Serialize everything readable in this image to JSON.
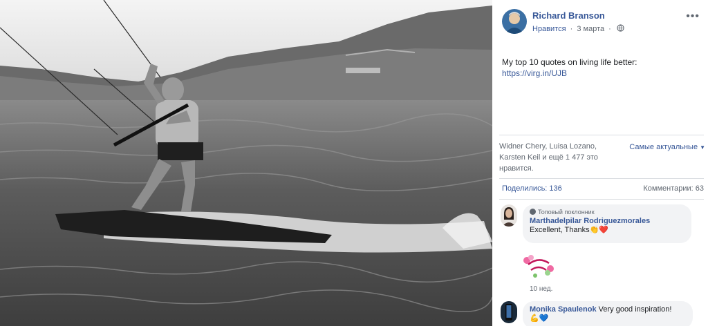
{
  "post": {
    "author": "Richard Branson",
    "like_link": "Нравится",
    "separator": "·",
    "date": "3 марта",
    "more_icon": "more-options-icon",
    "text": "My top 10 quotes on living life better:",
    "link": "https://virg.in/UJB"
  },
  "reactions": {
    "likes_text": "Widner Chery, Luisa Lozano, Karsten Keil и ещё 1 477 это нравится.",
    "sort_label": "Самые актуальные"
  },
  "stats": {
    "shares": "Поделились: 136",
    "comments": "Комментарии: 63"
  },
  "comments": [
    {
      "badge": "Топовый поклонник",
      "name": "Marthadelpilar Rodriguezmorales",
      "text": "Excellent, Thanks👏❤️",
      "time": "10 нед.",
      "sticker": "thank-you-sticker"
    },
    {
      "name": "Monika Spaulenok",
      "text": "Very good inspiration!",
      "emoji": "💪💙"
    }
  ],
  "colors": {
    "link": "#385898",
    "secondary": "#606770",
    "bubble": "#f2f3f5"
  }
}
